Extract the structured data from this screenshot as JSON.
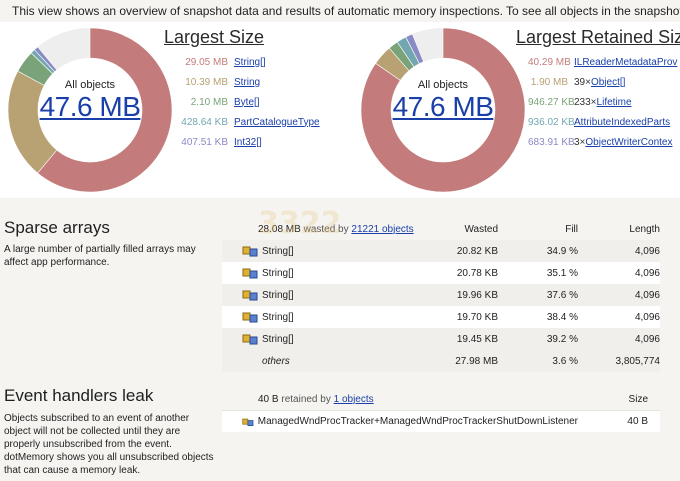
{
  "info_bar": {
    "text": "This view shows an overview of snapshot data and results of automatic memory inspections. To see all objects in the snapshot,"
  },
  "largest_size": {
    "title": "Largest Size",
    "center_caption": "All objects",
    "center_value": "47.6 MB",
    "items": [
      {
        "size": "29.05 MB",
        "name": "String[]",
        "mult": "",
        "color": "#c47b7b"
      },
      {
        "size": "10.39 MB",
        "name": "String",
        "mult": "",
        "color": "#b8a173"
      },
      {
        "size": "2.10 MB",
        "name": "Byte[]",
        "mult": "",
        "color": "#7aa37a"
      },
      {
        "size": "428.64 KB",
        "name": "PartCatalogueType",
        "mult": "",
        "color": "#73a7b0"
      },
      {
        "size": "407.51 KB",
        "name": "Int32[]",
        "mult": "",
        "color": "#8a8ac4"
      }
    ]
  },
  "largest_retained": {
    "title": "Largest Retained Size",
    "center_caption": "All objects",
    "center_value": "47.6 MB",
    "items": [
      {
        "size": "40.29 MB",
        "name": "ILReaderMetadataProv",
        "mult": "",
        "color": "#c47b7b"
      },
      {
        "size": "1.90 MB",
        "name": "Object[]",
        "mult": "39×",
        "color": "#b8a173"
      },
      {
        "size": "946.27 KB",
        "name": "Lifetime",
        "mult": "233×",
        "color": "#7aa37a"
      },
      {
        "size": "936.02 KB",
        "name": "AttributeIndexedParts",
        "mult": "",
        "color": "#73a7b0"
      },
      {
        "size": "683.91 KB",
        "name": "ObjectWriterContex",
        "mult": "3×",
        "color": "#8a8ac4"
      }
    ]
  },
  "sparse_arrays": {
    "title": "Sparse arrays",
    "description": "A large number of partially filled arrays may affect app performance.",
    "summary_size": "28.08 MB",
    "summary_mid": "wasted by",
    "summary_link": "21221 objects",
    "headers": {
      "wasted": "Wasted",
      "fill": "Fill",
      "length": "Length"
    },
    "rows": [
      {
        "name": "String[]",
        "wasted": "20.82 KB",
        "fill": "34.9 %",
        "length": "4,096"
      },
      {
        "name": "String[]",
        "wasted": "20.78 KB",
        "fill": "35.1 %",
        "length": "4,096"
      },
      {
        "name": "String[]",
        "wasted": "19.96 KB",
        "fill": "37.6 %",
        "length": "4,096"
      },
      {
        "name": "String[]",
        "wasted": "19.70 KB",
        "fill": "38.4 %",
        "length": "4,096"
      },
      {
        "name": "String[]",
        "wasted": "19.45 KB",
        "fill": "39.2 %",
        "length": "4,096"
      }
    ],
    "others": {
      "name": "others",
      "wasted": "27.98 MB",
      "fill": "3.6 %",
      "length": "3,805,774"
    }
  },
  "event_handlers": {
    "title": "Event handlers leak",
    "description": "Objects subscribed to an event of another object will not be collected until they are properly unsubscribed from the event. dotMemory shows you all unsubscribed objects that can cause a memory leak.",
    "summary_size": "40 B",
    "summary_mid": "retained by",
    "summary_link": "1 objects",
    "size_header": "Size",
    "row": {
      "name": "ManagedWndProcTracker+ManagedWndProcTrackerShutDownListener",
      "size": "40 B"
    }
  },
  "colors": {
    "link": "#1a3fa8",
    "main_slice": "#c47b7b"
  }
}
